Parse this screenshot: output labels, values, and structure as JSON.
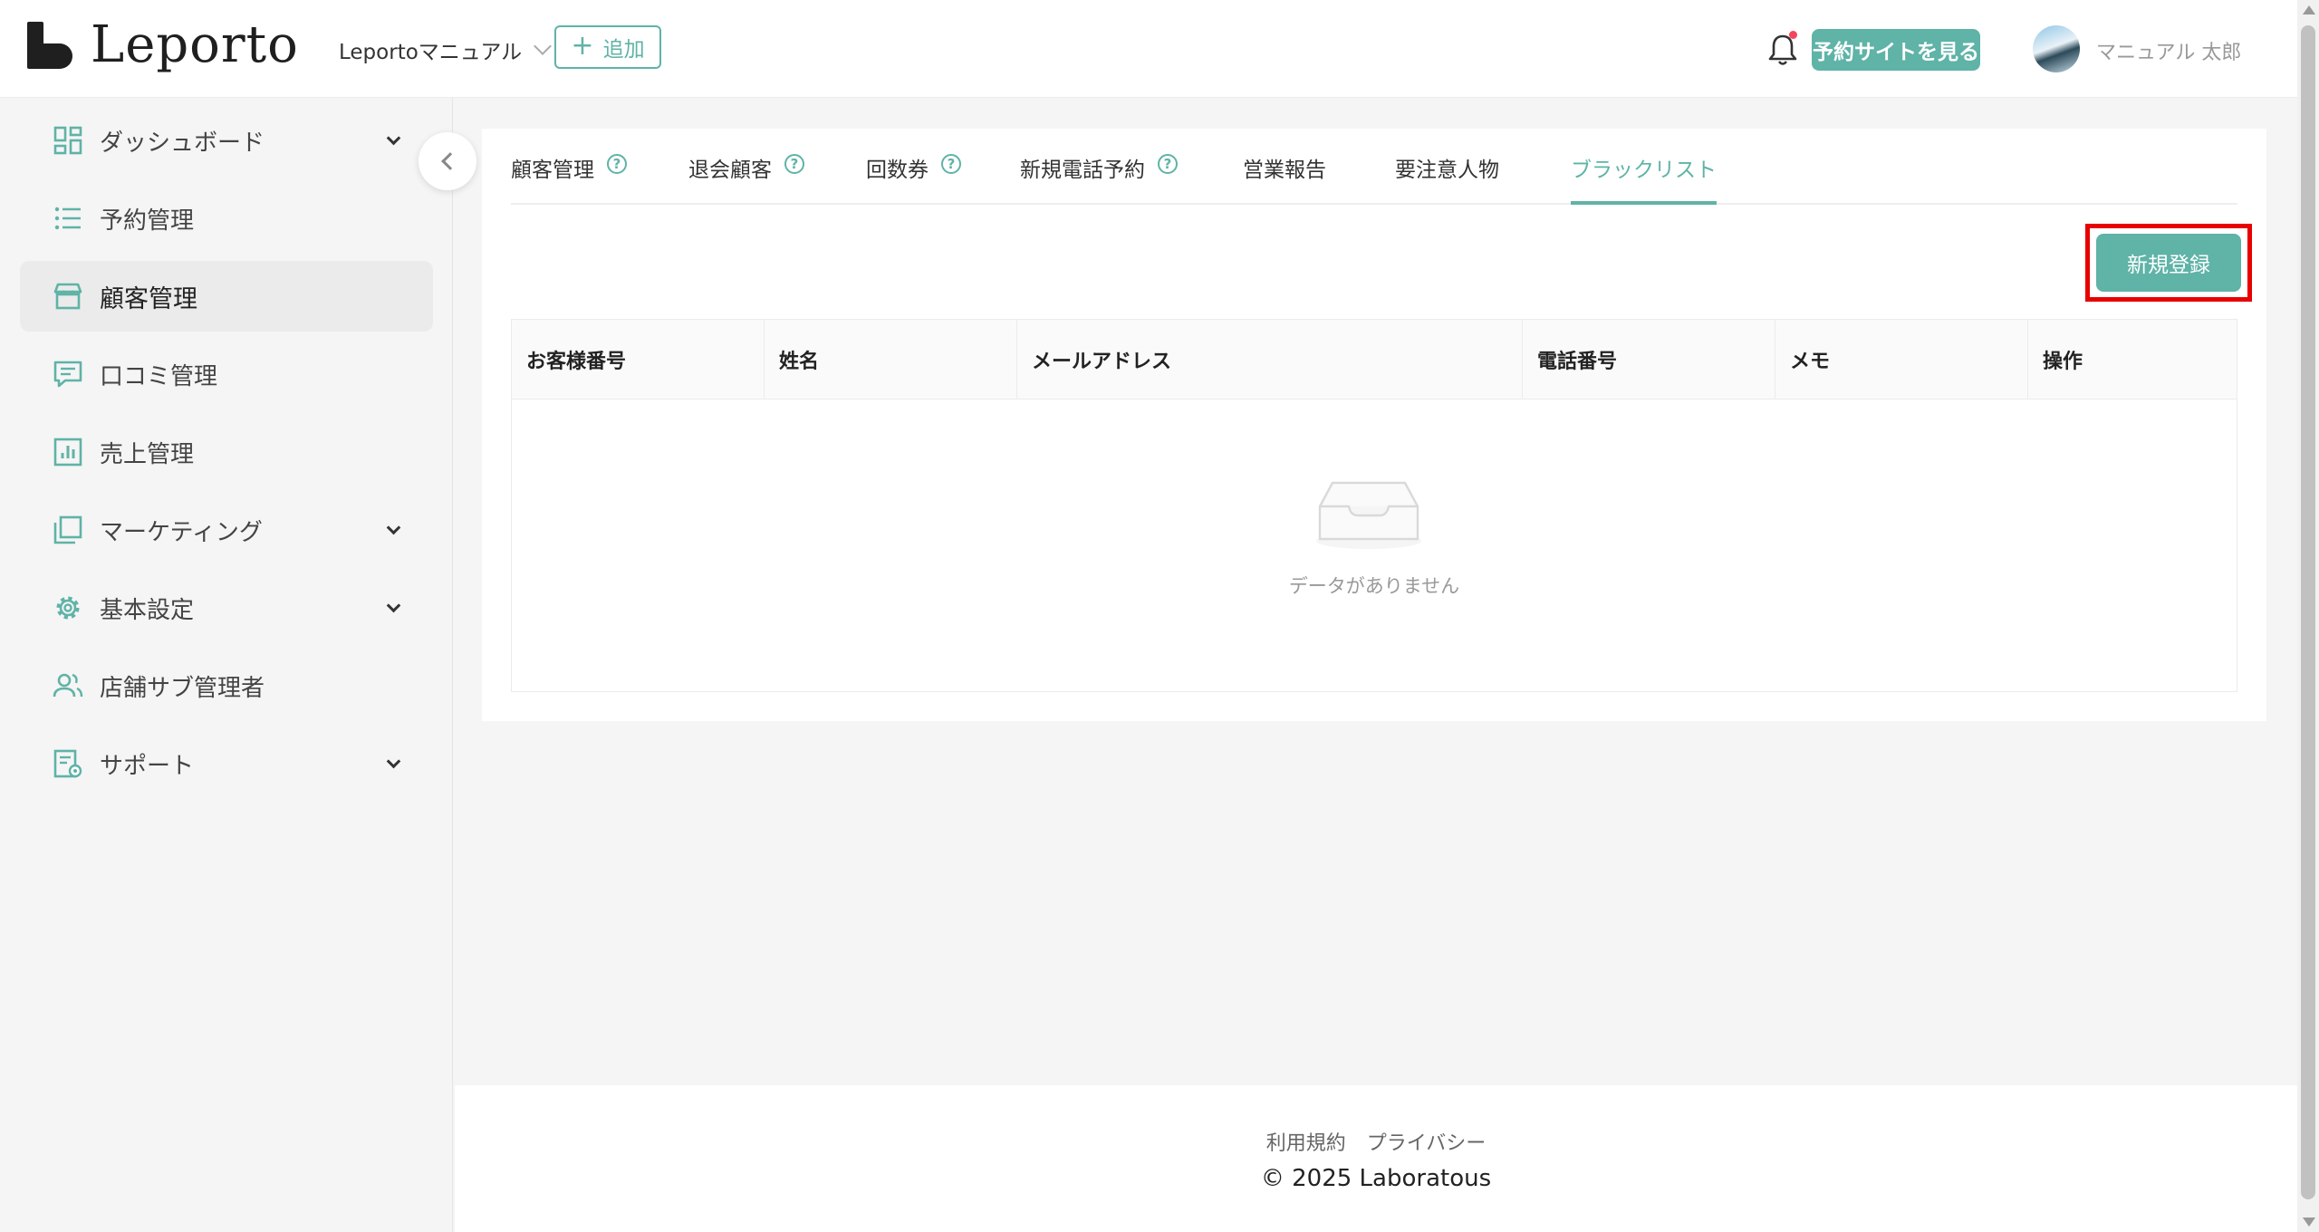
{
  "header": {
    "logo_text": "Leporto",
    "shop_name": "Leportoマニュアル",
    "add_label": "追加",
    "view_site_label": "予約サイトを見る",
    "user_name": "マニュアル 太郎"
  },
  "sidebar": {
    "items": [
      {
        "label": "ダッシュボード",
        "icon": "dashboard-icon",
        "expandable": true
      },
      {
        "label": "予約管理",
        "icon": "list-icon",
        "expandable": false
      },
      {
        "label": "顧客管理",
        "icon": "store-icon",
        "expandable": false,
        "active": true
      },
      {
        "label": "口コミ管理",
        "icon": "comment-icon",
        "expandable": false
      },
      {
        "label": "売上管理",
        "icon": "sales-chart-icon",
        "expandable": false
      },
      {
        "label": "マーケティング",
        "icon": "marketing-icon",
        "expandable": true
      },
      {
        "label": "基本設定",
        "icon": "gear-icon",
        "expandable": true
      },
      {
        "label": "店舗サブ管理者",
        "icon": "users-icon",
        "expandable": false
      },
      {
        "label": "サポート",
        "icon": "support-icon",
        "expandable": true
      }
    ]
  },
  "tabs": [
    {
      "label": "顧客管理",
      "help": true
    },
    {
      "label": "退会顧客",
      "help": true
    },
    {
      "label": "回数券",
      "help": true
    },
    {
      "label": "新規電話予約",
      "help": true
    },
    {
      "label": "営業報告",
      "help": false
    },
    {
      "label": "要注意人物",
      "help": false
    },
    {
      "label": "ブラックリスト",
      "help": false,
      "active": true
    }
  ],
  "main": {
    "new_button_label": "新規登録",
    "columns": [
      "お客様番号",
      "姓名",
      "メールアドレス",
      "電話番号",
      "メモ",
      "操作"
    ],
    "empty_text": "データがありません"
  },
  "footer": {
    "terms": "利用規約",
    "privacy": "プライバシー",
    "copyright": "2025 Laboratous"
  },
  "colors": {
    "accent": "#5fb3a7",
    "highlight": "#e80000",
    "notification_dot": "#f5455c"
  }
}
